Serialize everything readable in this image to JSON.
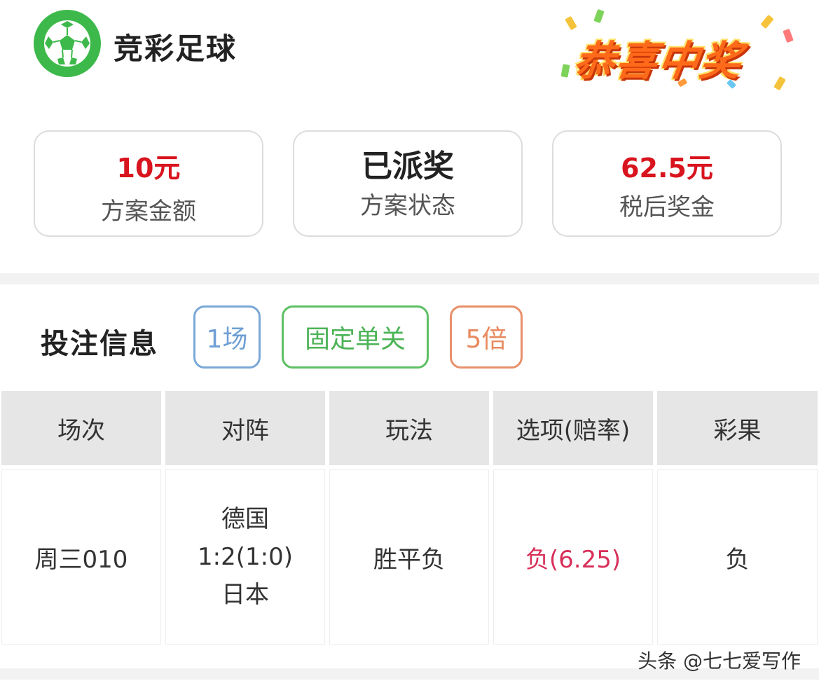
{
  "header": {
    "app_title": "竞彩足球",
    "banner_text": "恭喜中奖"
  },
  "summary": [
    {
      "value": "10元",
      "label": "方案金额"
    },
    {
      "value": "已派奖",
      "label": "方案状态"
    },
    {
      "value": "62.5元",
      "label": "税后奖金"
    }
  ],
  "bet_info": {
    "title": "投注信息",
    "tags": [
      "1场",
      "固定单关",
      "5倍"
    ]
  },
  "table": {
    "headers": [
      "场次",
      "对阵",
      "玩法",
      "选项(赔率)",
      "彩果"
    ],
    "row": {
      "match_no": "周三010",
      "home": "德国",
      "score": "1:2(1:0)",
      "away": "日本",
      "play": "胜平负",
      "pick": "负(6.25)",
      "result": "负"
    }
  },
  "watermark": "头条 @七七爱写作",
  "colors": {
    "brand_green": "#3cb94a",
    "amount_red": "#d8141e",
    "pick_red": "#d8305a",
    "tag_blue": "#7aa8d8",
    "tag_green": "#5cc063",
    "tag_orange": "#e8906a"
  }
}
